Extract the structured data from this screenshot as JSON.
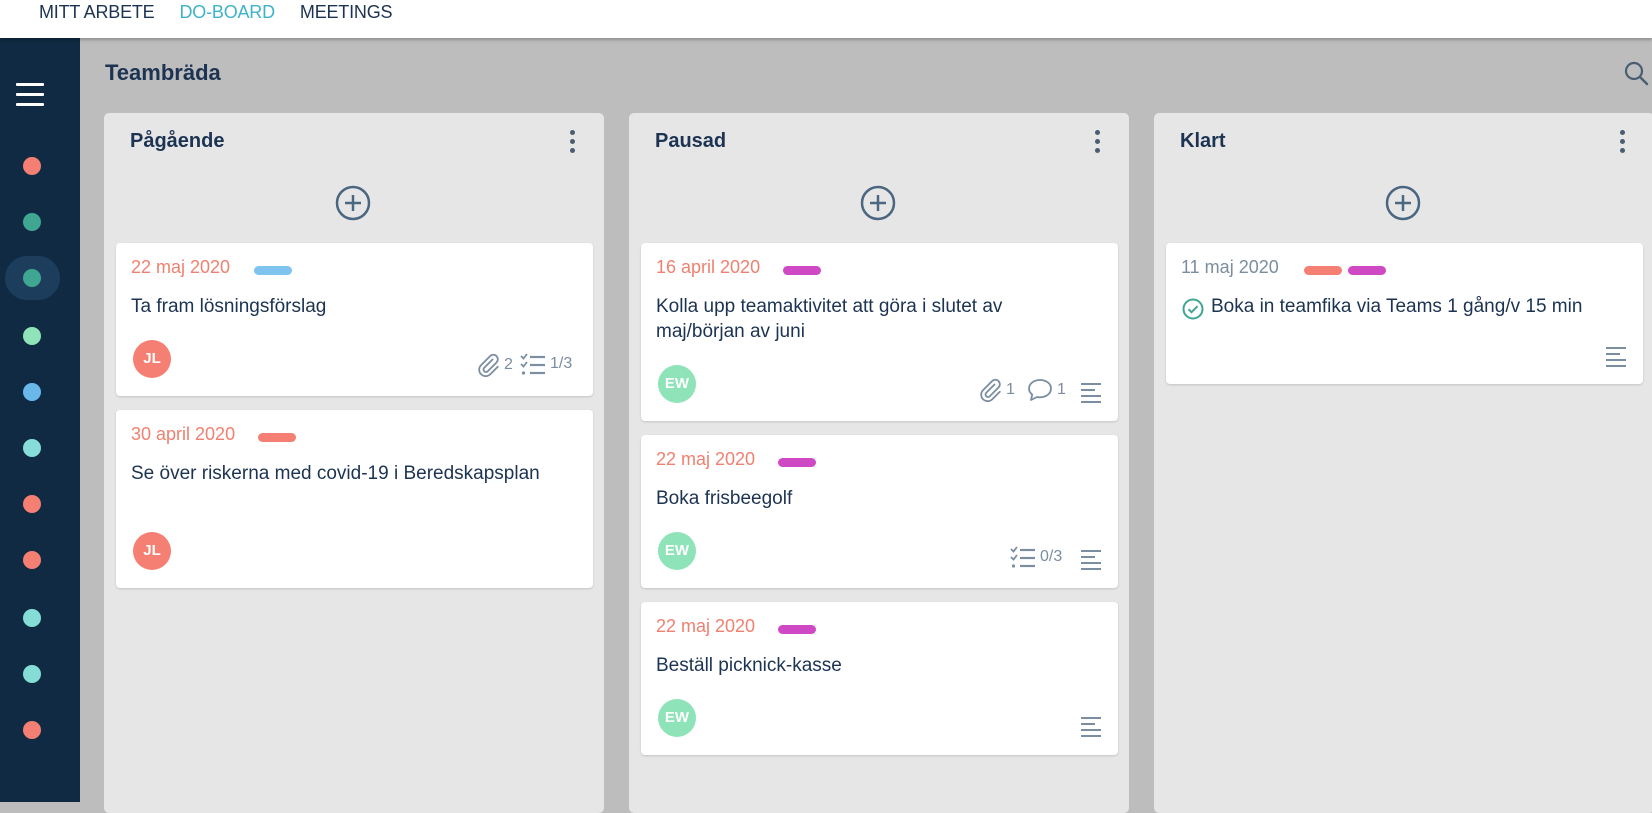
{
  "nav": {
    "items": [
      {
        "label": "MITT ARBETE",
        "active": false
      },
      {
        "label": "DO-BOARD",
        "active": true
      },
      {
        "label": "MEETINGS",
        "active": false
      }
    ],
    "active_color": "#3fb3c8"
  },
  "sidebar": {
    "menu_icon": "hamburger-icon",
    "dots": [
      {
        "color": "#f47f72"
      },
      {
        "color": "#3fa692"
      },
      {
        "color": "#3fa692",
        "active": true
      },
      {
        "color": "#8ee3b9"
      },
      {
        "color": "#68b8ec"
      },
      {
        "color": "#86ddd7"
      },
      {
        "color": "#f47f72"
      },
      {
        "color": "#f47f72"
      },
      {
        "color": "#86ddd7"
      },
      {
        "color": "#86ddd7"
      },
      {
        "color": "#f47f72"
      }
    ]
  },
  "board": {
    "title": "Teambräda",
    "search_icon": "search-icon"
  },
  "columns": [
    {
      "title": "Pågående",
      "cards": [
        {
          "date": "22 maj 2020",
          "tags": [
            "#7ec4ee"
          ],
          "title": "Ta fram lösningsförslag",
          "assignee": "JL",
          "attachments": "2",
          "checklist": "1/3"
        },
        {
          "date": "30 april 2020",
          "tags": [
            "#f47f72"
          ],
          "title": "Se över riskerna med covid-19 i Beredskapsplan",
          "assignee": "JL"
        }
      ]
    },
    {
      "title": "Pausad",
      "cards": [
        {
          "date": "16 april 2020",
          "tags": [
            "#cf48c4"
          ],
          "title": "Kolla upp teamaktivitet att göra i slutet av maj/början av juni",
          "assignee": "EW",
          "attachments": "1",
          "comments": "1"
        },
        {
          "date": "22 maj 2020",
          "tags": [
            "#cf48c4"
          ],
          "title": "Boka frisbeegolf",
          "assignee": "EW",
          "checklist": "0/3"
        },
        {
          "date": "22 maj 2020",
          "tags": [
            "#cf48c4"
          ],
          "title": "Beställ picknick-kasse",
          "assignee": "EW"
        }
      ]
    },
    {
      "title": "Klart",
      "cards": [
        {
          "date": "11 maj 2020",
          "tags": [
            "#f47f72",
            "#cf48c4"
          ],
          "title": "Boka in teamfika via Teams 1 gång/v 15 min",
          "completed": true
        }
      ]
    }
  ],
  "avatar_colors": {
    "JL": "#f47f72",
    "EW": "#8ee3b9"
  }
}
